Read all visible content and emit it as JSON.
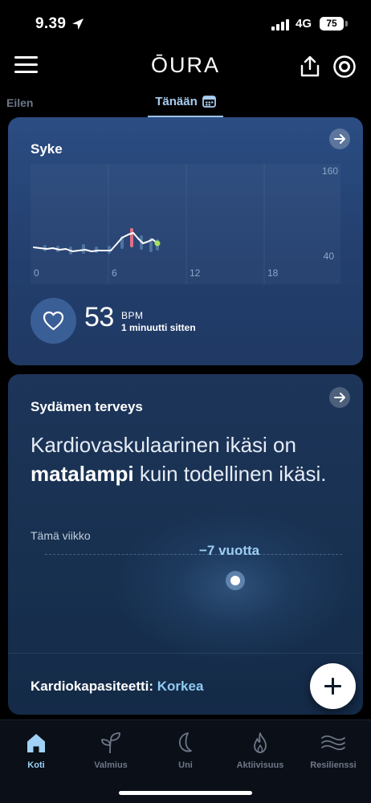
{
  "status_bar": {
    "time": "9.39",
    "network": "4G",
    "battery": "75"
  },
  "header": {
    "logo": "ŌURA"
  },
  "date_tabs": {
    "previous": "Eilen",
    "current": "Tänään"
  },
  "heart_rate_card": {
    "title": "Syke",
    "y_axis_top": "160",
    "y_axis_bottom": "40",
    "x_ticks": [
      "0",
      "6",
      "12",
      "18"
    ],
    "value": "53",
    "unit": "BPM",
    "updated": "1 minuutti sitten"
  },
  "heart_health_card": {
    "title": "Sydämen terveys",
    "headline_part1": "Kardiovaskulaarinen ikäsi on",
    "headline_bold": "matalampi",
    "headline_part2": " kuin todellinen ikäsi.",
    "week_label": "Tämä viikko",
    "years_label": "−7 vuotta",
    "capacity_label": "Kardiokapasiteetti: ",
    "capacity_value": "Korkea"
  },
  "bottom_nav": [
    {
      "label": "Koti",
      "icon": "home-icon",
      "active": true
    },
    {
      "label": "Valmius",
      "icon": "sprout-icon",
      "active": false
    },
    {
      "label": "Uni",
      "icon": "moon-icon",
      "active": false
    },
    {
      "label": "Aktiivisuus",
      "icon": "flame-icon",
      "active": false
    },
    {
      "label": "Resilienssi",
      "icon": "waves-icon",
      "active": false
    }
  ],
  "colors": {
    "accent": "#9fd2f6",
    "card_blue": "#2b4d83",
    "card_navy": "#17304f",
    "hr_line": "#ffffff",
    "hr_peak": "#e0708a",
    "hr_latest": "#a8e060"
  }
}
